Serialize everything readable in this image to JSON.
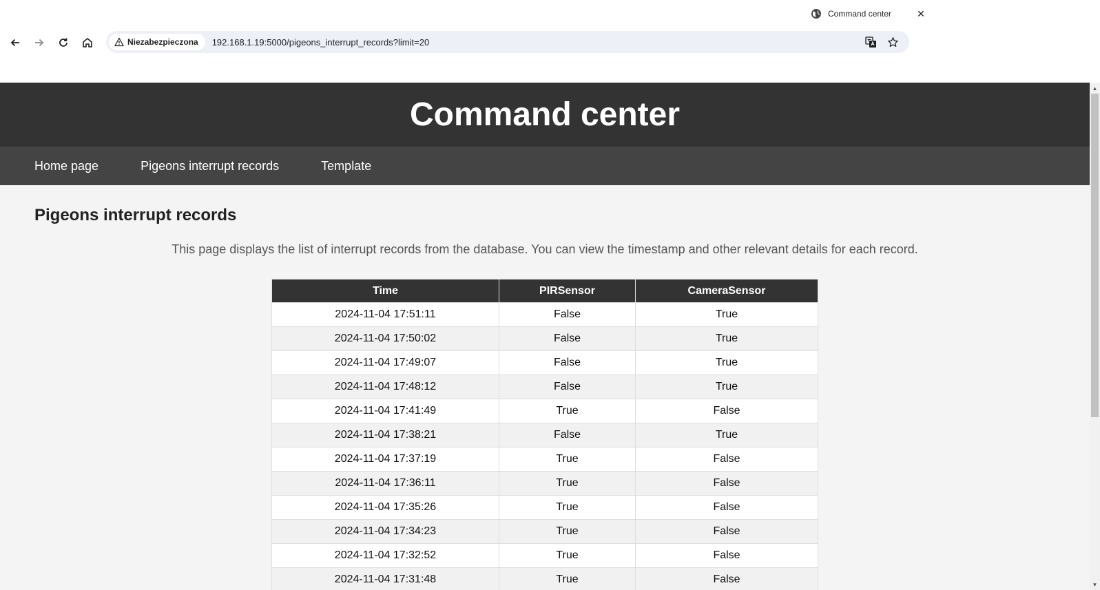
{
  "browser": {
    "tab": {
      "title": "Command center",
      "favicon": "globe-icon",
      "close_symbol": "✕"
    },
    "toolbar": {
      "security_label": "Niezabezpieczona",
      "url": "192.168.1.19:5000/pigeons_interrupt_records?limit=20"
    }
  },
  "site": {
    "title": "Command center",
    "nav": [
      {
        "label": "Home page"
      },
      {
        "label": "Pigeons interrupt records"
      },
      {
        "label": "Template"
      }
    ]
  },
  "page": {
    "heading": "Pigeons interrupt records",
    "description": "This page displays the list of interrupt records from the database. You can view the timestamp and other relevant details for each record.",
    "table": {
      "headers": [
        "Time",
        "PIRSensor",
        "CameraSensor"
      ],
      "rows": [
        [
          "2024-11-04 17:51:11",
          "False",
          "True"
        ],
        [
          "2024-11-04 17:50:02",
          "False",
          "True"
        ],
        [
          "2024-11-04 17:49:07",
          "False",
          "True"
        ],
        [
          "2024-11-04 17:48:12",
          "False",
          "True"
        ],
        [
          "2024-11-04 17:41:49",
          "True",
          "False"
        ],
        [
          "2024-11-04 17:38:21",
          "False",
          "True"
        ],
        [
          "2024-11-04 17:37:19",
          "True",
          "False"
        ],
        [
          "2024-11-04 17:36:11",
          "True",
          "False"
        ],
        [
          "2024-11-04 17:35:26",
          "True",
          "False"
        ],
        [
          "2024-11-04 17:34:23",
          "True",
          "False"
        ],
        [
          "2024-11-04 17:32:52",
          "True",
          "False"
        ],
        [
          "2024-11-04 17:31:48",
          "True",
          "False"
        ]
      ]
    }
  },
  "colors": {
    "header_bg": "#333333",
    "nav_bg": "#444444",
    "page_bg": "#f4f4f4",
    "omnibox_bg": "#edf0f7"
  }
}
